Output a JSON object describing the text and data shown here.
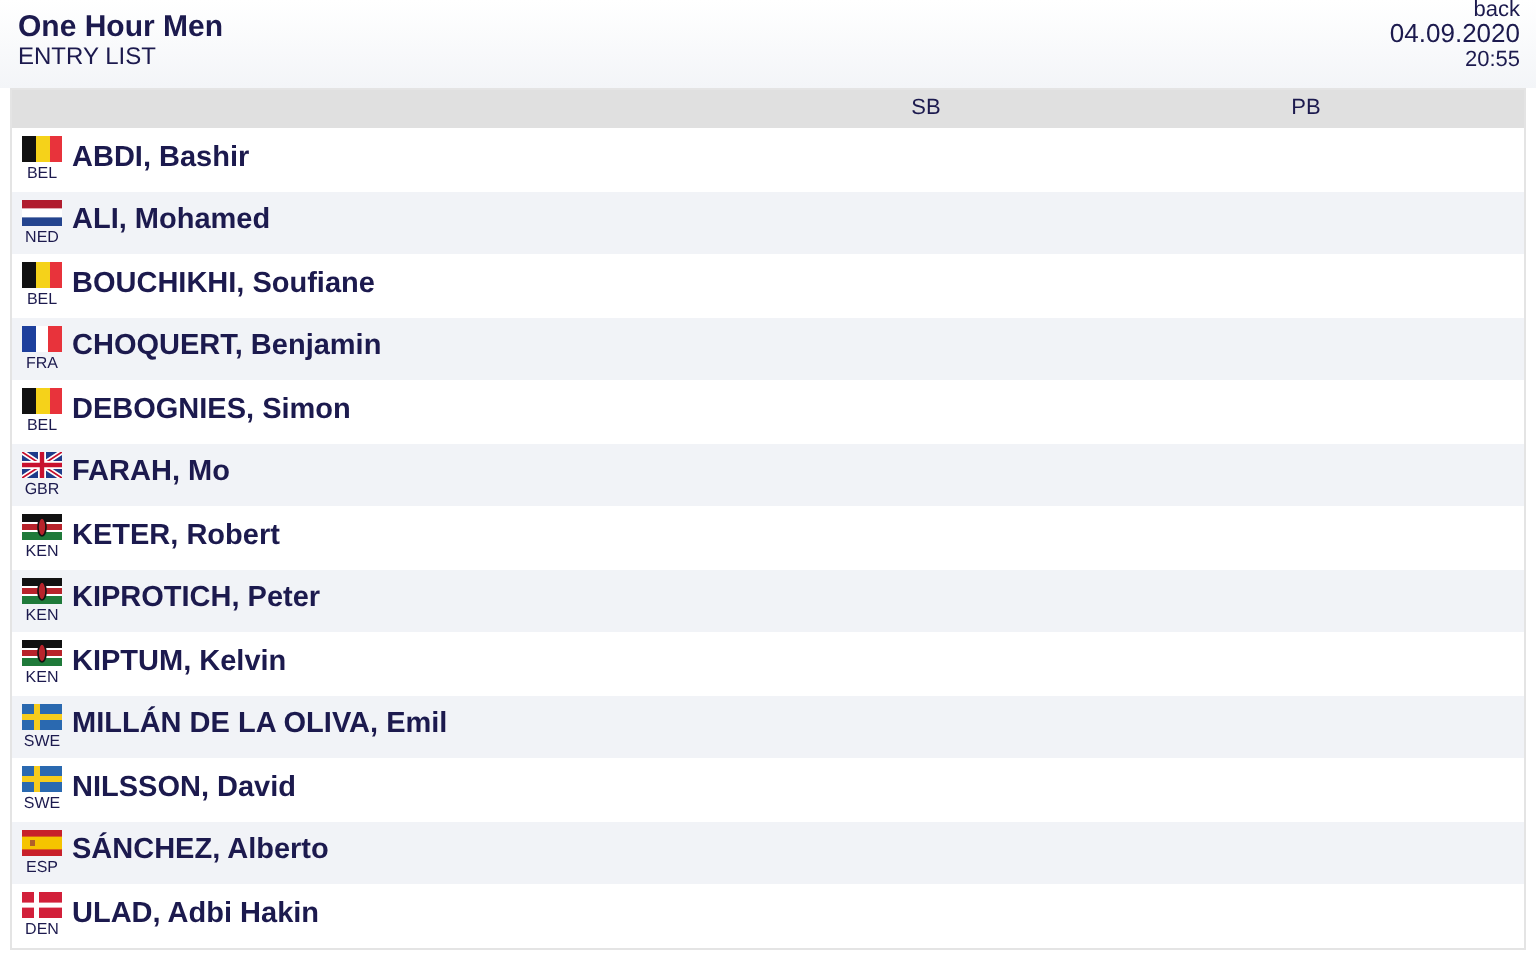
{
  "header": {
    "title": "One Hour Men",
    "subtitle": "ENTRY LIST",
    "back_link": "back",
    "date": "04.09.2020",
    "time": "20:55"
  },
  "table": {
    "columns": [
      "SB",
      "PB"
    ],
    "rows": [
      {
        "country": "BEL",
        "name": "ABDI, Bashir"
      },
      {
        "country": "NED",
        "name": "ALI, Mohamed"
      },
      {
        "country": "BEL",
        "name": "BOUCHIKHI, Soufiane"
      },
      {
        "country": "FRA",
        "name": "CHOQUERT, Benjamin"
      },
      {
        "country": "BEL",
        "name": "DEBOGNIES, Simon"
      },
      {
        "country": "GBR",
        "name": "FARAH, Mo"
      },
      {
        "country": "KEN",
        "name": "KETER, Robert"
      },
      {
        "country": "KEN",
        "name": "KIPROTICH, Peter"
      },
      {
        "country": "KEN",
        "name": "KIPTUM, Kelvin"
      },
      {
        "country": "SWE",
        "name": "MILLÁN DE LA OLIVA, Emil"
      },
      {
        "country": "SWE",
        "name": "NILSSON, David"
      },
      {
        "country": "ESP",
        "name": "SÁNCHEZ, Alberto"
      },
      {
        "country": "DEN",
        "name": "ULAD, Adbi Hakin"
      }
    ]
  }
}
